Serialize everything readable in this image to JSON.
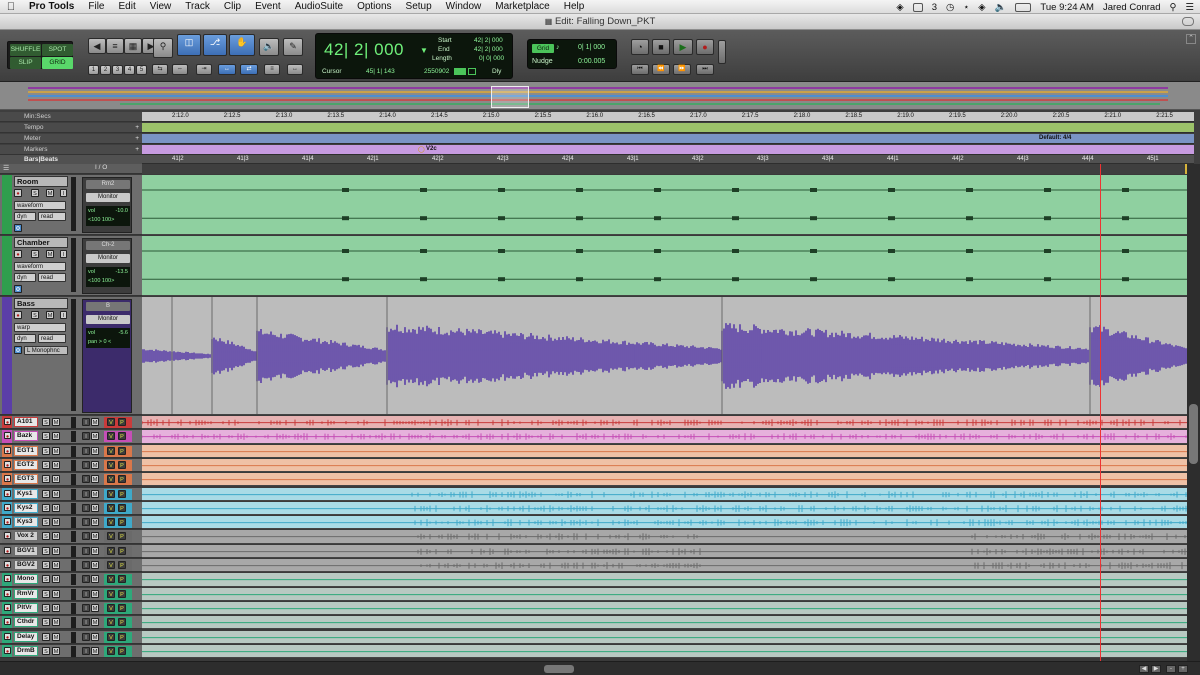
{
  "menubar": {
    "app": "Pro Tools",
    "items": [
      "File",
      "Edit",
      "View",
      "Track",
      "Clip",
      "Event",
      "AudioSuite",
      "Options",
      "Setup",
      "Window",
      "Marketplace",
      "Help"
    ],
    "status_count": "3",
    "clock": "Tue 9:24 AM",
    "user": "Jared Conrad"
  },
  "window": {
    "title": "Edit: Falling Down_PKT"
  },
  "toolbar": {
    "modes": {
      "shuffle": "SHUFFLE",
      "spot": "SPOT",
      "slip": "SLIP",
      "grid": "GRID"
    },
    "zoom_presets": [
      "1",
      "2",
      "3",
      "4",
      "5"
    ],
    "counter": {
      "main": "42| 2| 000",
      "start_label": "Start",
      "start_value": "42| 2| 000",
      "end_label": "End",
      "end_value": "42| 2| 000",
      "length_label": "Length",
      "length_value": "0| 0| 000",
      "cursor_label": "Cursor",
      "cursor_value": "45| 1| 143",
      "sample_value": "2550902",
      "dly_label": "Dly"
    },
    "grid": {
      "label": "Grid",
      "value": "0| 1| 000",
      "nudge_label": "Nudge",
      "nudge_value": "0:00.005"
    }
  },
  "rulers": {
    "minsecs": {
      "label": "Min:Secs",
      "ticks": [
        "2:12.0",
        "2:12.5",
        "2:13.0",
        "2:13.5",
        "2:14.0",
        "2:14.5",
        "2:15.0",
        "2:15.5",
        "2:16.0",
        "2:16.5",
        "2:17.0",
        "2:17.5",
        "2:18.0",
        "2:18.5",
        "2:19.0",
        "2:19.5",
        "2:20.0",
        "2:20.5",
        "2:21.0",
        "2:21.5"
      ]
    },
    "tempo": {
      "label": "Tempo"
    },
    "meter": {
      "label": "Meter",
      "value": "Default: 4/4"
    },
    "markers": {
      "label": "Markers",
      "marker": "V2c"
    },
    "bars": {
      "label": "Bars|Beats",
      "ticks": [
        "41|2",
        "41|3",
        "41|4",
        "42|1",
        "42|2",
        "42|3",
        "42|4",
        "43|1",
        "43|2",
        "43|3",
        "43|4",
        "44|1",
        "44|2",
        "44|3",
        "44|4",
        "45|1",
        "45|2"
      ]
    }
  },
  "io_header": "I / O",
  "big_tracks": [
    {
      "name": "Room",
      "view": "waveform",
      "dyn": "dyn",
      "auto": "read",
      "output": "Rm2",
      "monitor": "Monitor",
      "vol_label": "vol",
      "vol": "-10.0",
      "pan": "<100   100>",
      "color": "#2f9e4d",
      "lane": "#8fd0a0"
    },
    {
      "name": "Chamber",
      "view": "waveform",
      "dyn": "dyn",
      "auto": "read",
      "output": "Ch-2",
      "monitor": "Monitor",
      "vol_label": "vol",
      "vol": "-13.5",
      "pan": "<100   100>",
      "color": "#2f9e4d",
      "lane": "#8fd0a0"
    },
    {
      "name": "Bass",
      "view": "warp",
      "dyn": "dyn",
      "auto": "read",
      "output": "B",
      "monitor": "Monitor",
      "vol_label": "vol",
      "vol": "-5.6",
      "pan": "pan  > 0 <",
      "plugin": "L Monophnc",
      "color": "#5b3ea8",
      "lane": "#bcbcbc"
    }
  ],
  "small_tracks": [
    {
      "name": "A101",
      "color": "#c93b3b",
      "lane": "#e7b3b3"
    },
    {
      "name": "Bazk",
      "color": "#c54fb6",
      "lane": "#e6b1dc"
    },
    {
      "name": "EGT1",
      "color": "#d9774a",
      "lane": "#efc1a6"
    },
    {
      "name": "EGT2",
      "color": "#d9774a",
      "lane": "#efc1a6"
    },
    {
      "name": "EGT3",
      "color": "#d9774a",
      "lane": "#efc1a6"
    },
    {
      "name": "Kys1",
      "color": "#3fa9c9",
      "lane": "#a9dbe6"
    },
    {
      "name": "Kys2",
      "color": "#3fa9c9",
      "lane": "#a9dbe6"
    },
    {
      "name": "Kys3",
      "color": "#3fa9c9",
      "lane": "#a9dbe6"
    },
    {
      "name": "Vox 2",
      "color": "#6a6a6a",
      "lane": "#a8a8a8"
    },
    {
      "name": "BGV1",
      "color": "#6a6a6a",
      "lane": "#a8a8a8"
    },
    {
      "name": "BGV2",
      "color": "#6a6a6a",
      "lane": "#a8a8a8"
    },
    {
      "name": "Mono",
      "color": "#2ea87a",
      "lane": "#b8c9c2"
    },
    {
      "name": "RmVr",
      "color": "#2ea87a",
      "lane": "#b8c9c2"
    },
    {
      "name": "PltVr",
      "color": "#2ea87a",
      "lane": "#b8c9c2"
    },
    {
      "name": "Cthdr",
      "color": "#2ea87a",
      "lane": "#b8c9c2"
    },
    {
      "name": "Delay",
      "color": "#2ea87a",
      "lane": "#b8c9c2"
    },
    {
      "name": "DrmB",
      "color": "#2ea87a",
      "lane": "#b8c9c2"
    }
  ],
  "track_buttons": {
    "solo": "S",
    "mute": "M",
    "input": "I",
    "v": "V",
    "p": "P"
  },
  "colors": {
    "tempo": "#9cc26a",
    "meter": "#7a94c4",
    "markers": "#c79be0",
    "bars": "#515151",
    "counter_text": "#6ff07a"
  }
}
